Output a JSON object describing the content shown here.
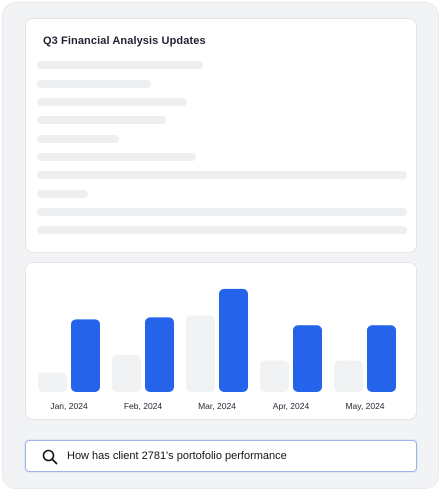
{
  "document": {
    "title": "Q3 Financial Analysis Updates"
  },
  "colors": {
    "accent": "#2563eb",
    "muted_bar": "#f1f2f4",
    "skeleton": "#eeeff1"
  },
  "chart_data": {
    "type": "bar",
    "categories": [
      "Jan, 2024",
      "Feb, 2024",
      "Mar, 2024",
      "Apr, 2024",
      "May, 2024"
    ],
    "series": [
      {
        "values": [
          20,
          38,
          78,
          32,
          32
        ]
      },
      {
        "values": [
          74,
          76,
          105,
          68,
          68
        ]
      }
    ],
    "ylim": [
      0,
      110
    ],
    "grid": false
  },
  "query_bar": {
    "icon": "search-icon",
    "text": "How has client 2781's portofolio performance"
  }
}
